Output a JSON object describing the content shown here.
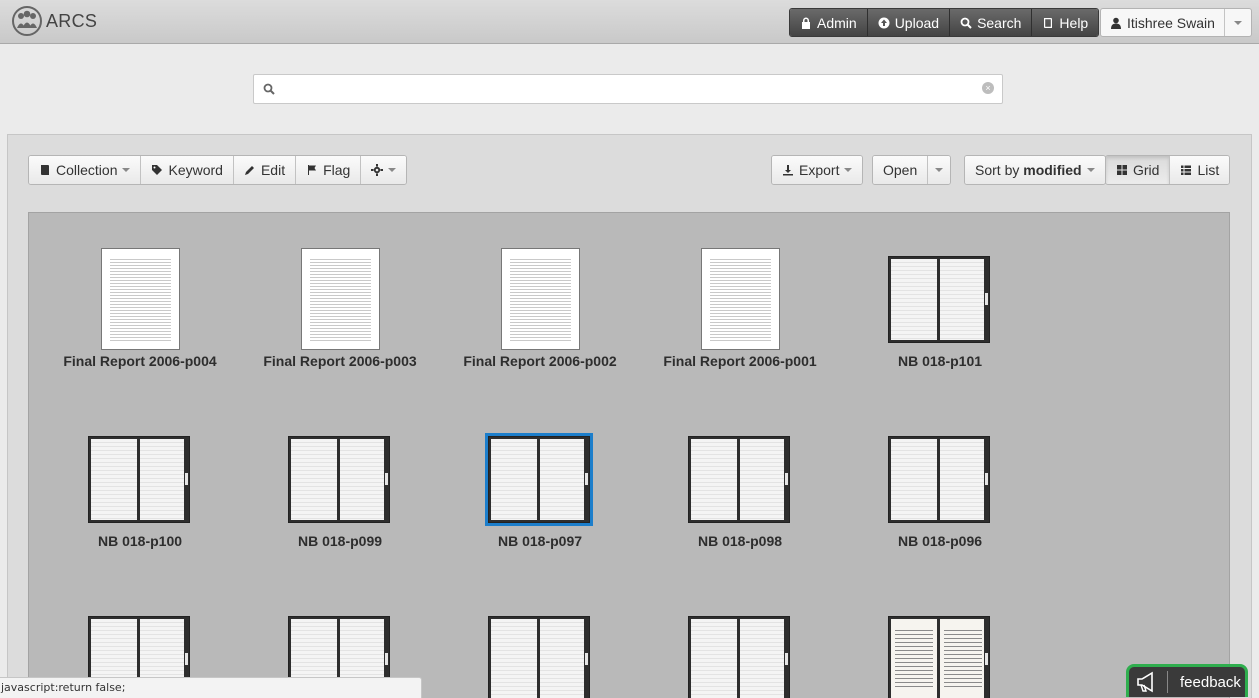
{
  "app": {
    "name": "ARCS"
  },
  "nav": {
    "items": [
      {
        "label": "Admin",
        "icon": "lock-icon"
      },
      {
        "label": "Upload",
        "icon": "upload-icon"
      },
      {
        "label": "Search",
        "icon": "search-icon"
      },
      {
        "label": "Help",
        "icon": "book-icon"
      }
    ],
    "user": "Itishree Swain"
  },
  "search": {
    "value": "",
    "placeholder": ""
  },
  "toolbar": {
    "left": [
      "Collection",
      "Keyword",
      "Edit",
      "Flag"
    ],
    "export": "Export",
    "open": "Open",
    "sort_prefix": "Sort by ",
    "sort_value": "modified",
    "views": [
      "Grid",
      "List"
    ],
    "active_view": "Grid"
  },
  "items": [
    {
      "label": "Final Report 2006-p004",
      "kind": "doc"
    },
    {
      "label": "Final Report 2006-p003",
      "kind": "doc"
    },
    {
      "label": "Final Report 2006-p002",
      "kind": "doc"
    },
    {
      "label": "Final Report 2006-p001",
      "kind": "doc"
    },
    {
      "label": "NB 018-p101",
      "kind": "notebook"
    },
    {
      "label": "NB 018-p100",
      "kind": "notebook"
    },
    {
      "label": "NB 018-p099",
      "kind": "notebook"
    },
    {
      "label": "NB 018-p097",
      "kind": "notebook",
      "selected": true
    },
    {
      "label": "NB 018-p098",
      "kind": "notebook"
    },
    {
      "label": "NB 018-p096",
      "kind": "notebook"
    }
  ],
  "status_text": "javascript:return false;",
  "feedback": "feedback",
  "colors": {
    "selected_border": "#1c7ecb",
    "feedback_border": "#2fae4e",
    "nav_bg": "#4f4f4f"
  }
}
